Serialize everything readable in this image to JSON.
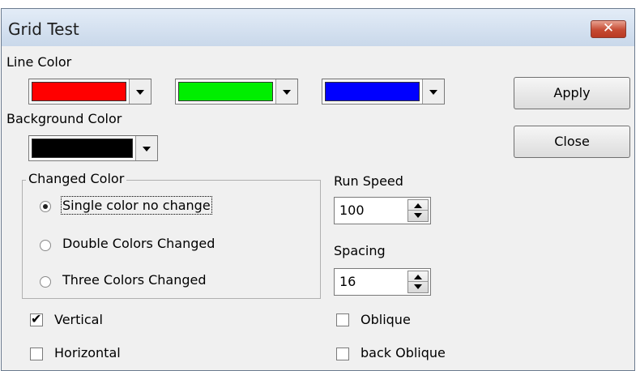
{
  "window": {
    "title": "Grid Test",
    "close_glyph": "✕"
  },
  "line_color": {
    "label": "Line Color",
    "colors": [
      "#ff0000",
      "#00ee00",
      "#0000ff"
    ]
  },
  "background_color": {
    "label": "Background Color",
    "color": "#000000"
  },
  "buttons": {
    "apply": "Apply",
    "close": "Close"
  },
  "changed_color": {
    "title": "Changed Color",
    "options": [
      {
        "label": "Single color no change",
        "selected": true
      },
      {
        "label": "Double Colors Changed",
        "selected": false
      },
      {
        "label": "Three Colors Changed",
        "selected": false
      }
    ]
  },
  "run_speed": {
    "label": "Run Speed",
    "value": "100"
  },
  "spacing": {
    "label": "Spacing",
    "value": "16"
  },
  "checkboxes": {
    "vertical": {
      "label": "Vertical",
      "checked": true,
      "mark": "✔"
    },
    "horizontal": {
      "label": "Horizontal",
      "checked": false
    },
    "oblique": {
      "label": "Oblique",
      "checked": false
    },
    "back_oblique": {
      "label": "back Oblique",
      "checked": false
    }
  }
}
